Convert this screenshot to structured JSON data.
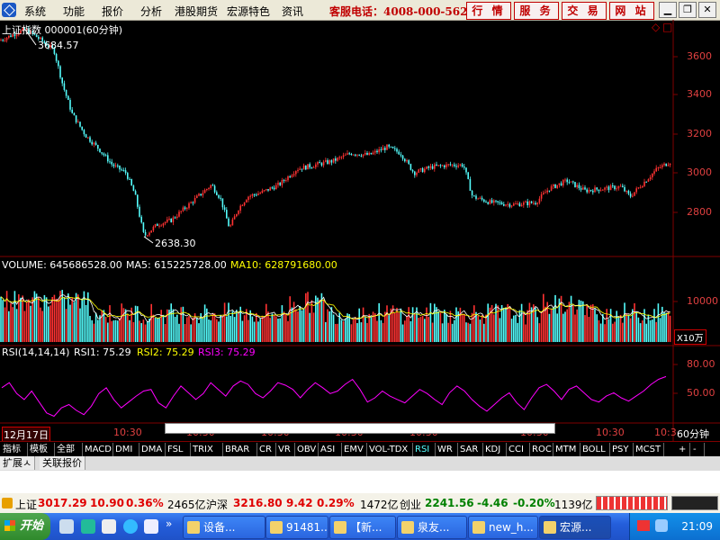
{
  "menu": {
    "items": [
      "系统",
      "功能",
      "报价",
      "分析",
      "港股期货",
      "宏源特色",
      "资讯"
    ],
    "hotline": "客服电话：4008-000-562",
    "buttons": [
      "行 情",
      "服 务",
      "交 易",
      "网 站"
    ]
  },
  "chart_data": [
    {
      "type": "candlestick",
      "title": "上证指数 000001(60分钟)",
      "y_ticks": [
        "3600",
        "3400",
        "3200",
        "3000",
        "2800"
      ],
      "ylim": [
        2560,
        3720
      ],
      "annotations": [
        {
          "text": "3684.57",
          "value": 3684.57
        },
        {
          "text": "2638.30",
          "value": 2638.3
        }
      ],
      "close_path": [
        [
          0,
          3630
        ],
        [
          15,
          3660
        ],
        [
          28,
          3684.57
        ],
        [
          40,
          3650
        ],
        [
          60,
          3580
        ],
        [
          70,
          3400
        ],
        [
          80,
          3260
        ],
        [
          95,
          3150
        ],
        [
          110,
          3080
        ],
        [
          125,
          3000
        ],
        [
          140,
          2960
        ],
        [
          150,
          2850
        ],
        [
          160,
          2640
        ],
        [
          175,
          2700
        ],
        [
          190,
          2720
        ],
        [
          205,
          2780
        ],
        [
          220,
          2840
        ],
        [
          235,
          2900
        ],
        [
          245,
          2830
        ],
        [
          255,
          2680
        ],
        [
          265,
          2780
        ],
        [
          275,
          2840
        ],
        [
          290,
          2860
        ],
        [
          310,
          2900
        ],
        [
          330,
          2980
        ],
        [
          350,
          3000
        ],
        [
          370,
          3020
        ],
        [
          390,
          3060
        ],
        [
          410,
          3050
        ],
        [
          430,
          3090
        ],
        [
          445,
          3060
        ],
        [
          460,
          2960
        ],
        [
          480,
          2990
        ],
        [
          500,
          3000
        ],
        [
          515,
          3000
        ],
        [
          525,
          2840
        ],
        [
          545,
          2810
        ],
        [
          570,
          2800
        ],
        [
          595,
          2810
        ],
        [
          610,
          2880
        ],
        [
          630,
          2920
        ],
        [
          650,
          2870
        ],
        [
          670,
          2880
        ],
        [
          690,
          2890
        ],
        [
          700,
          2840
        ],
        [
          715,
          2910
        ],
        [
          730,
          2980
        ],
        [
          745,
          3017.29
        ]
      ]
    },
    {
      "type": "bar",
      "title": "VOLUME: 645686528.00",
      "series_labels": [
        "MA5: 615225728.00",
        "MA10: 628791680.00"
      ],
      "y_ticks": [
        "10000"
      ],
      "unit_label": "X10万",
      "ylim": [
        0,
        16000
      ]
    },
    {
      "type": "line",
      "title": "RSI(14,14,14)",
      "series_labels": [
        "RSI1: 75.29",
        "RSI2: 75.29",
        "RSI3: 75.29"
      ],
      "y_ticks": [
        "80.00",
        "50.00"
      ],
      "ylim": [
        20,
        95
      ],
      "values": [
        62,
        68,
        55,
        48,
        58,
        45,
        32,
        28,
        38,
        42,
        35,
        30,
        40,
        55,
        62,
        48,
        38,
        45,
        52,
        58,
        60,
        44,
        38,
        52,
        64,
        56,
        48,
        55,
        68,
        60,
        52,
        64,
        70,
        66,
        55,
        50,
        58,
        68,
        65,
        60,
        50,
        60,
        68,
        62,
        55,
        58,
        66,
        72,
        60,
        45,
        50,
        58,
        52,
        48,
        44,
        52,
        60,
        55,
        48,
        42,
        56,
        64,
        58,
        48,
        40,
        34,
        42,
        50,
        56,
        44,
        36,
        50,
        62,
        66,
        58,
        48,
        60,
        64,
        56,
        48,
        45,
        52,
        56,
        50,
        46,
        52,
        58,
        66,
        72,
        75.29
      ]
    }
  ],
  "time_axis": {
    "date_label": "12月17日",
    "time_labels": [
      "10:30",
      "10:30",
      "10:30",
      "10:30",
      "10:30",
      "10:30",
      "10:30",
      "10:3"
    ],
    "period": "60分钟"
  },
  "indicator_tabs": [
    "指标",
    "模板",
    "全部",
    "MACD",
    "DMI",
    "DMA",
    "FSL",
    "TRIX",
    "BRAR",
    "CR",
    "VR",
    "OBV",
    "ASI",
    "EMV",
    "VOL-TDX",
    "RSI",
    "WR",
    "SAR",
    "KDJ",
    "CCI",
    "ROC",
    "MTM",
    "BOLL",
    "PSY",
    "MCST"
  ],
  "active_tab": "RSI",
  "tab_controls": [
    "+",
    "-"
  ],
  "ext_tabs": [
    "扩展ㅅ",
    "关联报价"
  ],
  "ticker": {
    "sh_name": "上证",
    "sh_price": "3017.29",
    "sh_chg": "10.90",
    "sh_pct": "0.36%",
    "sh_amt": "2465亿",
    "sz_name": "沪深",
    "sz_price": "3216.80",
    "sz_chg": "9.42",
    "sz_pct": "0.29%",
    "sz_amt": "1472亿",
    "cy_name": "创业",
    "cy_price": "2241.56",
    "cy_chg": "-4.46",
    "cy_pct": "-0.20%",
    "cy_amt": "1139亿"
  },
  "taskbar": {
    "start": "开始",
    "tasks": [
      "设备...",
      "91481...",
      "【新...",
      "泉友...",
      "new_h...",
      "宏源..."
    ],
    "clock": "21:09"
  },
  "colors": {
    "up": "#ff3232",
    "down": "#54fcfc",
    "ma5": "#ffffff",
    "ma10": "#ffff00",
    "rsi": "#ff00ff",
    "axis": "#800000"
  }
}
